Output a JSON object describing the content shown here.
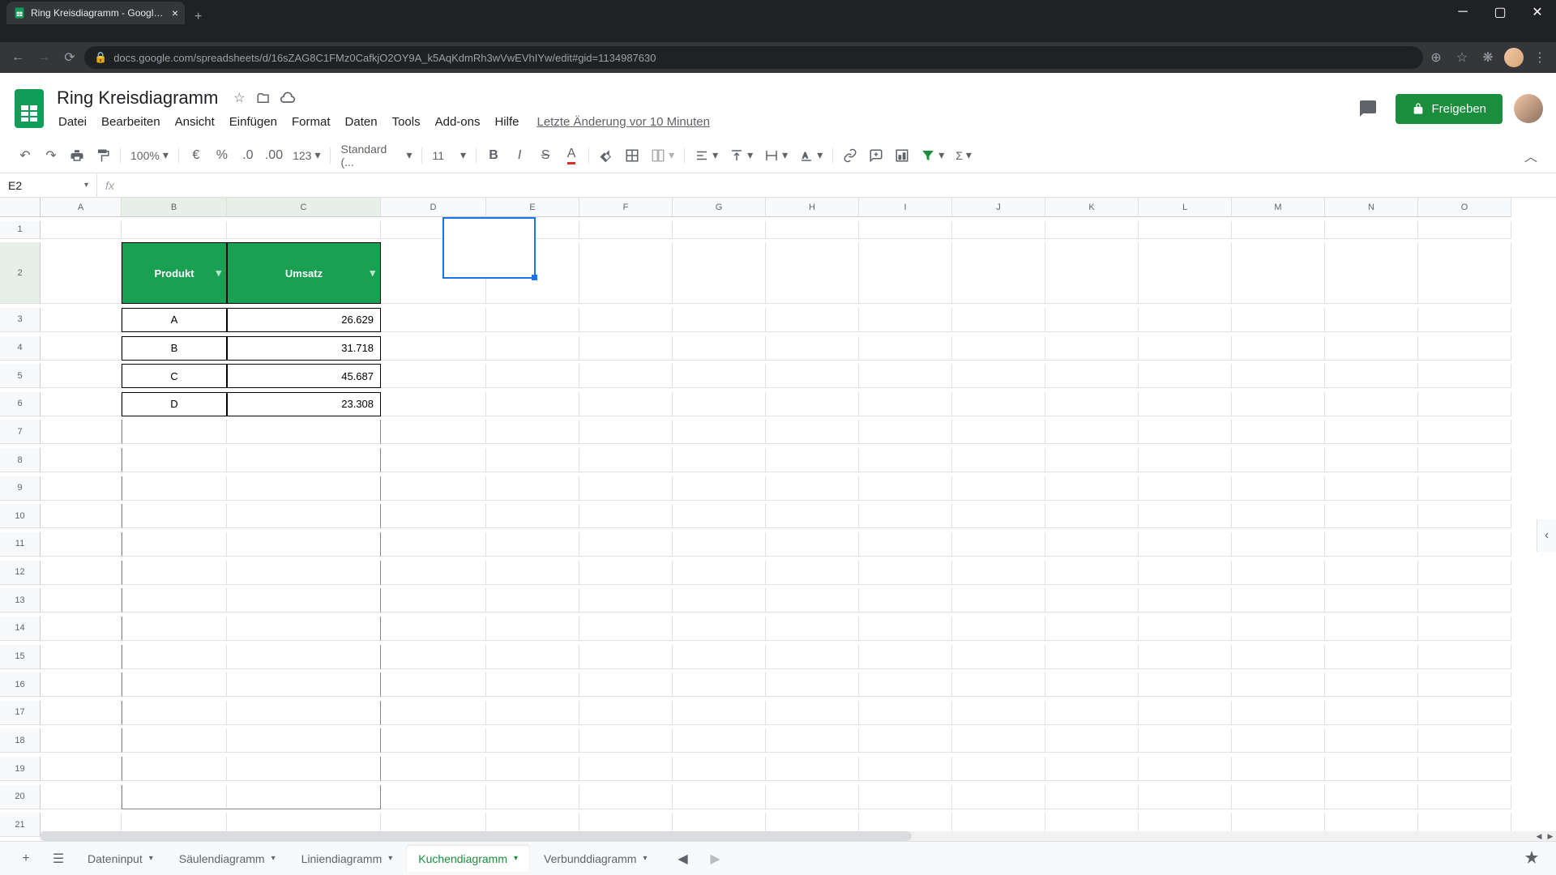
{
  "browser": {
    "tab_title": "Ring Kreisdiagramm - Google Ta",
    "url": "docs.google.com/spreadsheets/d/16sZAG8C1FMz0CafkjO2OY9A_k5AqKdmRh3wVwEVhIYw/edit#gid=1134987630"
  },
  "doc": {
    "title": "Ring Kreisdiagramm",
    "last_edit": "Letzte Änderung vor 10 Minuten"
  },
  "menus": {
    "file": "Datei",
    "edit": "Bearbeiten",
    "view": "Ansicht",
    "insert": "Einfügen",
    "format": "Format",
    "data": "Daten",
    "tools": "Tools",
    "addons": "Add-ons",
    "help": "Hilfe"
  },
  "share": {
    "label": "Freigeben"
  },
  "toolbar": {
    "zoom": "100%",
    "currency": "€",
    "percent": "%",
    "num_format": "123",
    "font": "Standard (...",
    "font_size": "11"
  },
  "formula": {
    "cell_ref": "E2",
    "value": ""
  },
  "columns": [
    "A",
    "B",
    "C",
    "D",
    "E",
    "F",
    "G",
    "H",
    "I",
    "J",
    "K",
    "L",
    "M",
    "N",
    "O"
  ],
  "table_headers": {
    "produkt": "Produkt",
    "umsatz": "Umsatz"
  },
  "table_rows": [
    {
      "produkt": "A",
      "umsatz": "26.629"
    },
    {
      "produkt": "B",
      "umsatz": "31.718"
    },
    {
      "produkt": "C",
      "umsatz": "45.687"
    },
    {
      "produkt": "D",
      "umsatz": "23.308"
    }
  ],
  "sheet_tabs": {
    "dateninput": "Dateninput",
    "saulen": "Säulendiagramm",
    "linien": "Liniendiagramm",
    "kuchen": "Kuchendiagramm",
    "verbund": "Verbunddiagramm"
  },
  "selected_cell": "E2"
}
